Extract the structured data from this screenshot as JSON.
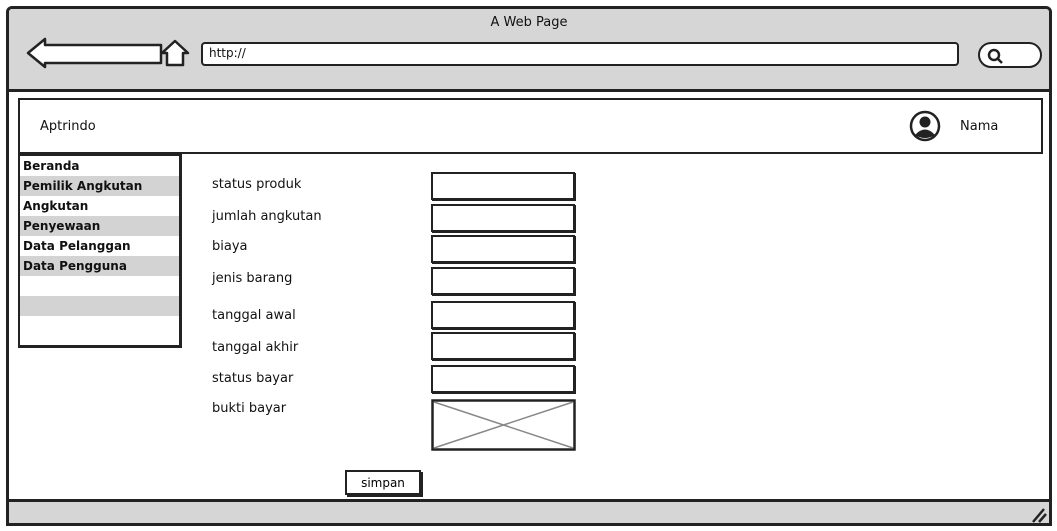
{
  "window": {
    "title": "A Web Page"
  },
  "address_bar": {
    "url": "http://"
  },
  "icons": {
    "back": "back-arrow-icon",
    "home": "home-icon",
    "search": "search-icon",
    "avatar": "user-avatar-icon",
    "image": "image-placeholder-icon",
    "resize": "resize-grip-icon"
  },
  "header": {
    "brand": "Aptrindo",
    "user_name": "Nama"
  },
  "sidebar": {
    "items": [
      {
        "label": "Beranda"
      },
      {
        "label": "Pemilik Angkutan"
      },
      {
        "label": "Angkutan"
      },
      {
        "label": "Penyewaan"
      },
      {
        "label": "Data Pelanggan"
      },
      {
        "label": "Data Pengguna"
      }
    ]
  },
  "form": {
    "fields": [
      {
        "label": "status produk",
        "value": ""
      },
      {
        "label": "jumlah angkutan",
        "value": ""
      },
      {
        "label": "biaya",
        "value": ""
      },
      {
        "label": "jenis barang",
        "value": ""
      },
      {
        "label": "tanggal awal",
        "value": ""
      },
      {
        "label": "tanggal akhir",
        "value": ""
      },
      {
        "label": "status bayar",
        "value": ""
      }
    ],
    "upload_label": "bukti bayar",
    "save_label": "simpan"
  },
  "colors": {
    "chrome": "#d6d6d6",
    "stripe": "#d3d3d3",
    "stroke": "#222222"
  }
}
